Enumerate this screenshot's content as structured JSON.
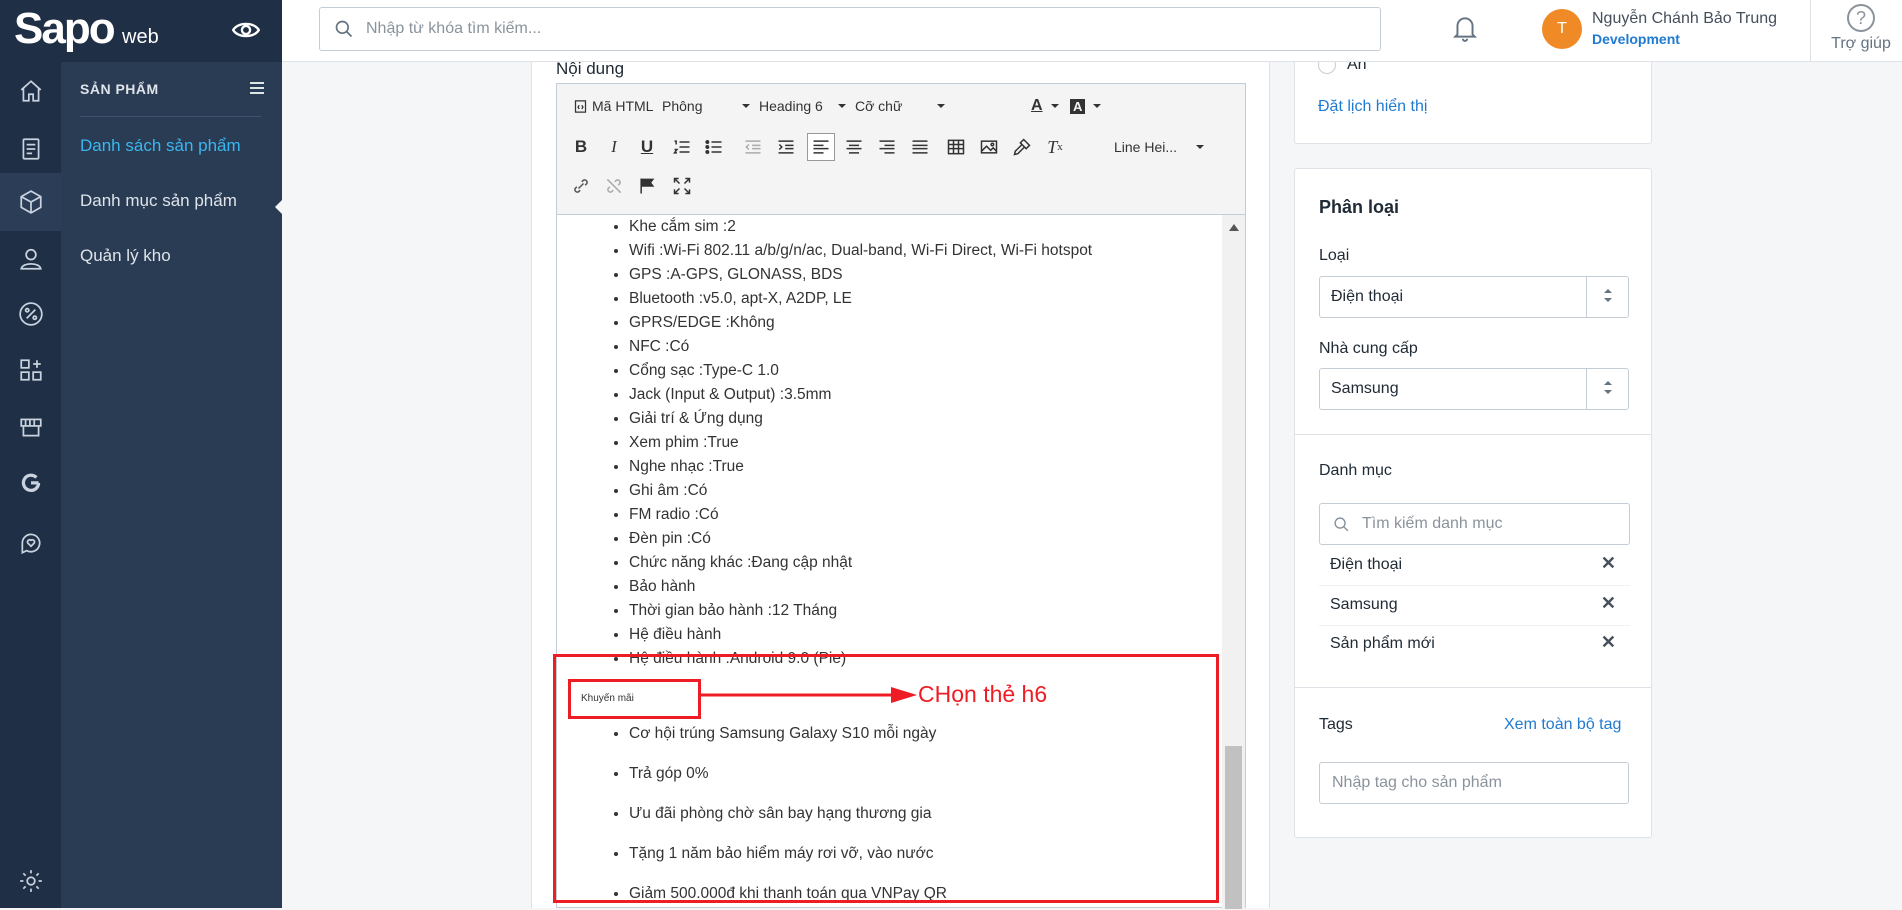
{
  "brand": {
    "name": "Sapo",
    "suffix": "web"
  },
  "rail": {
    "icons": [
      "home-icon",
      "orders-icon",
      "box-icon",
      "user-icon",
      "discount-icon",
      "apps-icon",
      "store-icon",
      "google-icon",
      "support-icon",
      "settings-icon"
    ]
  },
  "sidebar": {
    "title": "SẢN PHẨM",
    "items": [
      {
        "label": "Danh sách sản phẩm"
      },
      {
        "label": "Danh mục sản phẩm"
      },
      {
        "label": "Quản lý kho"
      }
    ]
  },
  "topbar": {
    "search_placeholder": "Nhập từ khóa tìm kiếm...",
    "avatar_initial": "T",
    "user_name": "Nguyễn Chánh Bảo Trung",
    "user_role": "Development",
    "help_label": "Trợ giúp"
  },
  "editor": {
    "label": "Nội dung",
    "toolbar": {
      "html": "Mã HTML",
      "font": "Phông",
      "heading": "Heading 6",
      "size": "Cỡ chữ",
      "line_height": "Line Hei..."
    },
    "specs": [
      "Khe cắm sim :2",
      "Wifi :Wi-Fi 802.11 a/b/g/n/ac, Dual-band, Wi-Fi Direct, Wi-Fi hotspot",
      "GPS :A-GPS, GLONASS, BDS",
      "Bluetooth :v5.0, apt-X, A2DP, LE",
      "GPRS/EDGE :Không",
      "NFC :Có",
      "Cổng sạc :Type-C 1.0",
      "Jack (Input & Output) :3.5mm",
      "Giải trí & Ứng dụng",
      "Xem phim :True",
      "Nghe nhạc :True",
      "Ghi âm :Có",
      "FM radio :Có",
      "Đèn pin :Có",
      "Chức năng khác :Đang cập nhật",
      "Bảo hành",
      "Thời gian bảo hành :12 Tháng",
      "Hệ điều hành",
      "Hệ điều hành :Android 9.0 (Pie)"
    ],
    "h6_text": "Khuyến mãi",
    "promos": [
      "Cơ hội trúng Samsung Galaxy S10 mỗi ngày",
      "Trả góp 0%",
      "Ưu đãi phòng chờ sân bay hạng thương gia",
      "Tặng 1 năm bảo hiểm máy rơi vỡ, vào nước",
      "Giảm 500.000đ khi thanh toán qua VNPay QR"
    ]
  },
  "annotation": {
    "text": "CHọn thẻ h6",
    "color": "#ee1c24"
  },
  "visibility": {
    "hidden_label": "Ẩn",
    "schedule_link": "Đặt lịch hiển thị"
  },
  "classification": {
    "title": "Phân loại",
    "type_label": "Loại",
    "type_value": "Điện thoại",
    "vendor_label": "Nhà cung cấp",
    "vendor_value": "Samsung",
    "collections_label": "Danh mục",
    "collections_placeholder": "Tìm kiếm danh mục",
    "collections": [
      "Điện thoại",
      "Samsung",
      "Sản phẩm mới"
    ],
    "tags_label": "Tags",
    "tags_link": "Xem toàn bộ tag",
    "tags_placeholder": "Nhập tag cho sản phẩm"
  },
  "colors": {
    "sidebar": "#1f2f46",
    "subnav": "#2a3b54",
    "active": "#3ab6f0",
    "link": "#1f7ad2",
    "avatar": "#ef8a26"
  }
}
